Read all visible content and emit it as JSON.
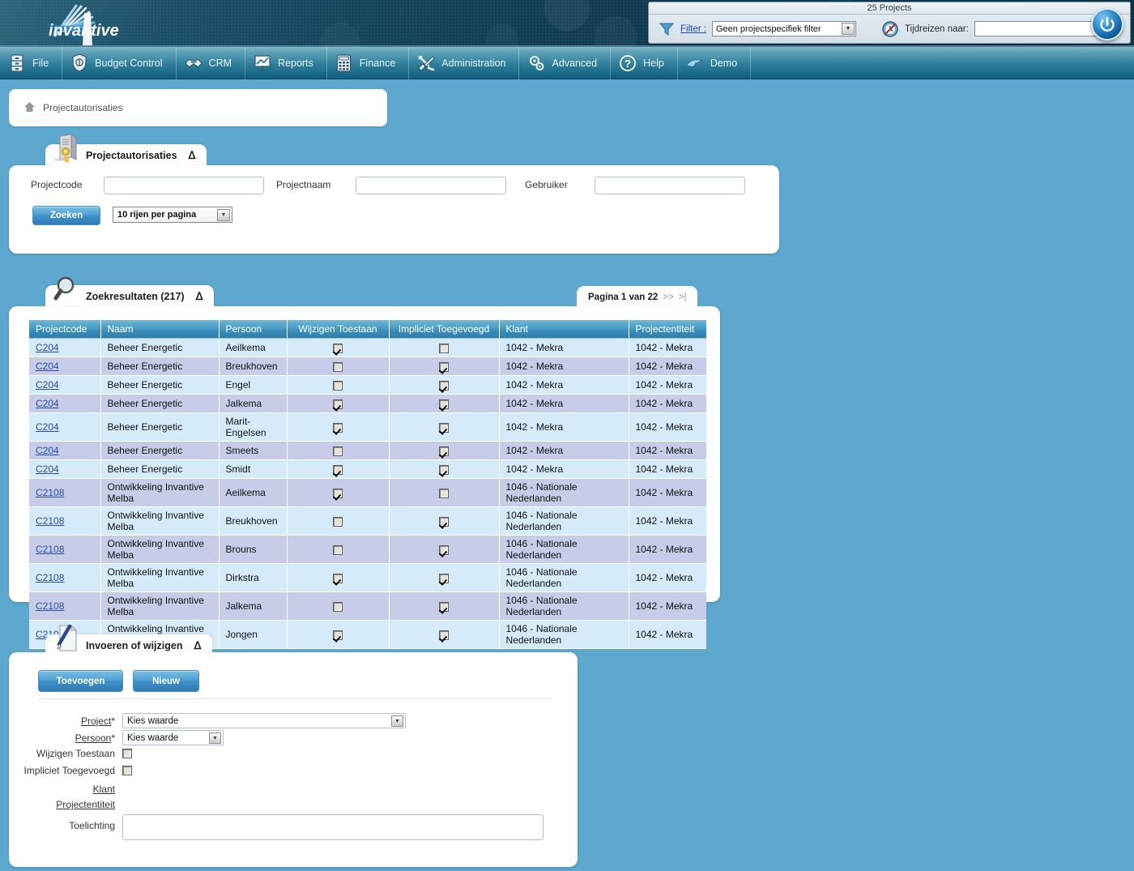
{
  "header": {
    "logo_text": "invantive",
    "toolpanel": {
      "title": "25 Projects",
      "filter_label": "Filter :",
      "filter_value": "Geen projectspecifiek filter",
      "timetravel_label": "Tijdreizen naar:",
      "timetravel_value": "",
      "funnel_icon": "funnel-icon",
      "clock_icon": "time-travel-icon",
      "power_icon": "power-icon"
    }
  },
  "menu": {
    "items": [
      {
        "label": "",
        "icon": "file-cabinet-icon"
      },
      {
        "label": "File",
        "icon": ""
      },
      {
        "label": "",
        "icon": "budget-shield-icon"
      },
      {
        "label": "Budget Control",
        "icon": ""
      },
      {
        "label": "",
        "icon": "handshake-icon"
      },
      {
        "label": "CRM",
        "icon": ""
      },
      {
        "label": "",
        "icon": "presentation-chart-icon"
      },
      {
        "label": "Reports",
        "icon": ""
      },
      {
        "label": "",
        "icon": "calculator-icon"
      },
      {
        "label": "Finance",
        "icon": ""
      },
      {
        "label": "",
        "icon": "tools-wrench-icon"
      },
      {
        "label": "Administration",
        "icon": ""
      },
      {
        "label": "",
        "icon": "gears-icon"
      },
      {
        "label": "Advanced",
        "icon": ""
      },
      {
        "label": "",
        "icon": "help-question-icon"
      },
      {
        "label": "Help",
        "icon": ""
      },
      {
        "label": "",
        "icon": "demo-bird-icon"
      },
      {
        "label": "Demo",
        "icon": ""
      }
    ],
    "groups": [
      {
        "icon": "file-cabinet-icon",
        "label": "File"
      },
      {
        "icon": "budget-shield-icon",
        "label": "Budget Control"
      },
      {
        "icon": "handshake-icon",
        "label": "CRM"
      },
      {
        "icon": "presentation-chart-icon",
        "label": "Reports"
      },
      {
        "icon": "calculator-icon",
        "label": "Finance"
      },
      {
        "icon": "tools-wrench-icon",
        "label": "Administration"
      },
      {
        "icon": "gears-icon",
        "label": "Advanced"
      },
      {
        "icon": "help-question-icon",
        "label": "Help"
      },
      {
        "icon": "demo-bird-icon",
        "label": "Demo"
      }
    ]
  },
  "breadcrumb": {
    "home_icon": "home-icon",
    "text": "Projectautorisaties"
  },
  "search_panel": {
    "tab_title": "Projectautorisaties",
    "tab_icon": "cabinet-key-icon",
    "collapse_icon": "chevron-up-icon",
    "fields": {
      "projectcode_label": "Projectcode",
      "projectcode_value": "",
      "projectnaam_label": "Projectnaam",
      "projectnaam_value": "",
      "gebruiker_label": "Gebruiker",
      "gebruiker_value": ""
    },
    "search_button": "Zoeken",
    "rows_per_page": "10 rijen per pagina"
  },
  "results_panel": {
    "tab_title": "Zoekresultaten (217)",
    "tab_icon": "magnifier-icon",
    "collapse_icon": "chevron-up-icon",
    "pagination": {
      "text": "Pagina 1 van 22",
      "next": ">>",
      "last": ">|"
    },
    "columns": [
      "Projectcode",
      "Naam",
      "Persoon",
      "Wijzigen Toestaan",
      "Impliciet Toegevoegd",
      "Klant",
      "Projectentiteit"
    ],
    "rows": [
      {
        "projectcode": "C204",
        "naam": "Beheer Energetic",
        "persoon": "Aeilkema",
        "wijzigen": true,
        "impliciet": false,
        "klant": "1042 - Mekra",
        "entiteit": "1042 - Mekra"
      },
      {
        "projectcode": "C204",
        "naam": "Beheer Energetic",
        "persoon": "Breukhoven",
        "wijzigen": false,
        "impliciet": true,
        "klant": "1042 - Mekra",
        "entiteit": "1042 - Mekra"
      },
      {
        "projectcode": "C204",
        "naam": "Beheer Energetic",
        "persoon": "Engel",
        "wijzigen": false,
        "impliciet": true,
        "klant": "1042 - Mekra",
        "entiteit": "1042 - Mekra"
      },
      {
        "projectcode": "C204",
        "naam": "Beheer Energetic",
        "persoon": "Jalkema",
        "wijzigen": true,
        "impliciet": true,
        "klant": "1042 - Mekra",
        "entiteit": "1042 - Mekra"
      },
      {
        "projectcode": "C204",
        "naam": "Beheer Energetic",
        "persoon": "Marit-Engelsen",
        "wijzigen": true,
        "impliciet": true,
        "klant": "1042 - Mekra",
        "entiteit": "1042 - Mekra"
      },
      {
        "projectcode": "C204",
        "naam": "Beheer Energetic",
        "persoon": "Smeets",
        "wijzigen": false,
        "impliciet": true,
        "klant": "1042 - Mekra",
        "entiteit": "1042 - Mekra"
      },
      {
        "projectcode": "C204",
        "naam": "Beheer Energetic",
        "persoon": "Smidt",
        "wijzigen": true,
        "impliciet": true,
        "klant": "1042 - Mekra",
        "entiteit": "1042 - Mekra"
      },
      {
        "projectcode": "C2108",
        "naam": "Ontwikkeling Invantive Melba",
        "persoon": "Aeilkema",
        "wijzigen": true,
        "impliciet": false,
        "klant": "1046 - Nationale Nederlanden",
        "entiteit": "1042 - Mekra"
      },
      {
        "projectcode": "C2108",
        "naam": "Ontwikkeling Invantive Melba",
        "persoon": "Breukhoven",
        "wijzigen": false,
        "impliciet": true,
        "klant": "1046 - Nationale Nederlanden",
        "entiteit": "1042 - Mekra"
      },
      {
        "projectcode": "C2108",
        "naam": "Ontwikkeling Invantive Melba",
        "persoon": "Brouns",
        "wijzigen": false,
        "impliciet": true,
        "klant": "1046 - Nationale Nederlanden",
        "entiteit": "1042 - Mekra"
      },
      {
        "projectcode": "C2108",
        "naam": "Ontwikkeling Invantive Melba",
        "persoon": "Dirkstra",
        "wijzigen": true,
        "impliciet": true,
        "klant": "1046 - Nationale Nederlanden",
        "entiteit": "1042 - Mekra"
      },
      {
        "projectcode": "C2108",
        "naam": "Ontwikkeling Invantive Melba",
        "persoon": "Jalkema",
        "wijzigen": false,
        "impliciet": true,
        "klant": "1046 - Nationale Nederlanden",
        "entiteit": "1042 - Mekra"
      },
      {
        "projectcode": "C2108",
        "naam": "Ontwikkeling Invantive Melba",
        "persoon": "Jongen",
        "wijzigen": true,
        "impliciet": true,
        "klant": "1046 - Nationale Nederlanden",
        "entiteit": "1042 - Mekra"
      }
    ]
  },
  "edit_panel": {
    "tab_title": "Invoeren of wijzigen",
    "tab_icon": "document-pen-icon",
    "collapse_icon": "chevron-up-icon",
    "buttons": {
      "add": "Toevoegen",
      "new": "Nieuw"
    },
    "fields": {
      "project_label": "Project",
      "project_required": "*",
      "project_value": "Kies waarde",
      "persoon_label": "Persoon",
      "persoon_required": "*",
      "persoon_value": "Kies waarde",
      "wijzigen_label": "Wijzigen Toestaan",
      "wijzigen_checked": false,
      "impliciet_label": "Impliciet Toegevoegd",
      "impliciet_checked": false,
      "klant_label": "Klant",
      "klant_value": "",
      "entiteit_label": "Projectentiteit",
      "entiteit_value": "",
      "toelichting_label": "Toelichting",
      "toelichting_value": ""
    }
  },
  "colors": {
    "page_bg": "#5ea7ce",
    "banner_dark": "#123a52",
    "menu_blue": "#2e7e9b",
    "row_odd": "#d5ebfa",
    "row_even": "#c7cde9",
    "link": "#2b4f9e"
  }
}
